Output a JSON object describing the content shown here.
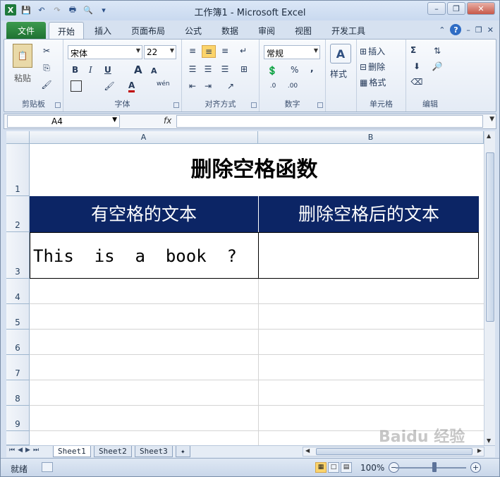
{
  "window": {
    "title": "工作簿1 - Microsoft Excel"
  },
  "tabs": {
    "file": "文件",
    "items": [
      "开始",
      "插入",
      "页面布局",
      "公式",
      "数据",
      "审阅",
      "视图",
      "开发工具"
    ]
  },
  "ribbon": {
    "clipboard": {
      "label": "剪贴板",
      "paste": "粘贴"
    },
    "font": {
      "label": "字体",
      "name": "宋体",
      "size": "22",
      "bold": "B",
      "italic": "I",
      "underline": "U",
      "grow": "A",
      "shrink": "A",
      "color": "A",
      "phonetic": "wén"
    },
    "alignment": {
      "label": "对齐方式"
    },
    "number": {
      "label": "数字",
      "format": "常规",
      "percent": "%",
      "comma": ","
    },
    "styles": {
      "label": "样式"
    },
    "cells": {
      "label": "单元格",
      "insert": "插入",
      "delete": "删除",
      "format": "格式"
    },
    "editing": {
      "label": "编辑",
      "sum": "Σ"
    }
  },
  "formula_bar": {
    "name_box": "A4",
    "fx": "fx",
    "value": ""
  },
  "sheet": {
    "columns": [
      "A",
      "B"
    ],
    "rows": [
      "1",
      "2",
      "3",
      "4",
      "5",
      "6",
      "7",
      "8",
      "9"
    ],
    "title": "删除空格函数",
    "header_a": "有空格的文本",
    "header_b": "删除空格后的文本",
    "cell_a3": "This  is  a  book  ?",
    "cell_b3": ""
  },
  "sheet_tabs": [
    "Sheet1",
    "Sheet2",
    "Sheet3"
  ],
  "status": {
    "ready": "就绪",
    "zoom": "100%"
  },
  "watermark": "Baidu 经验"
}
